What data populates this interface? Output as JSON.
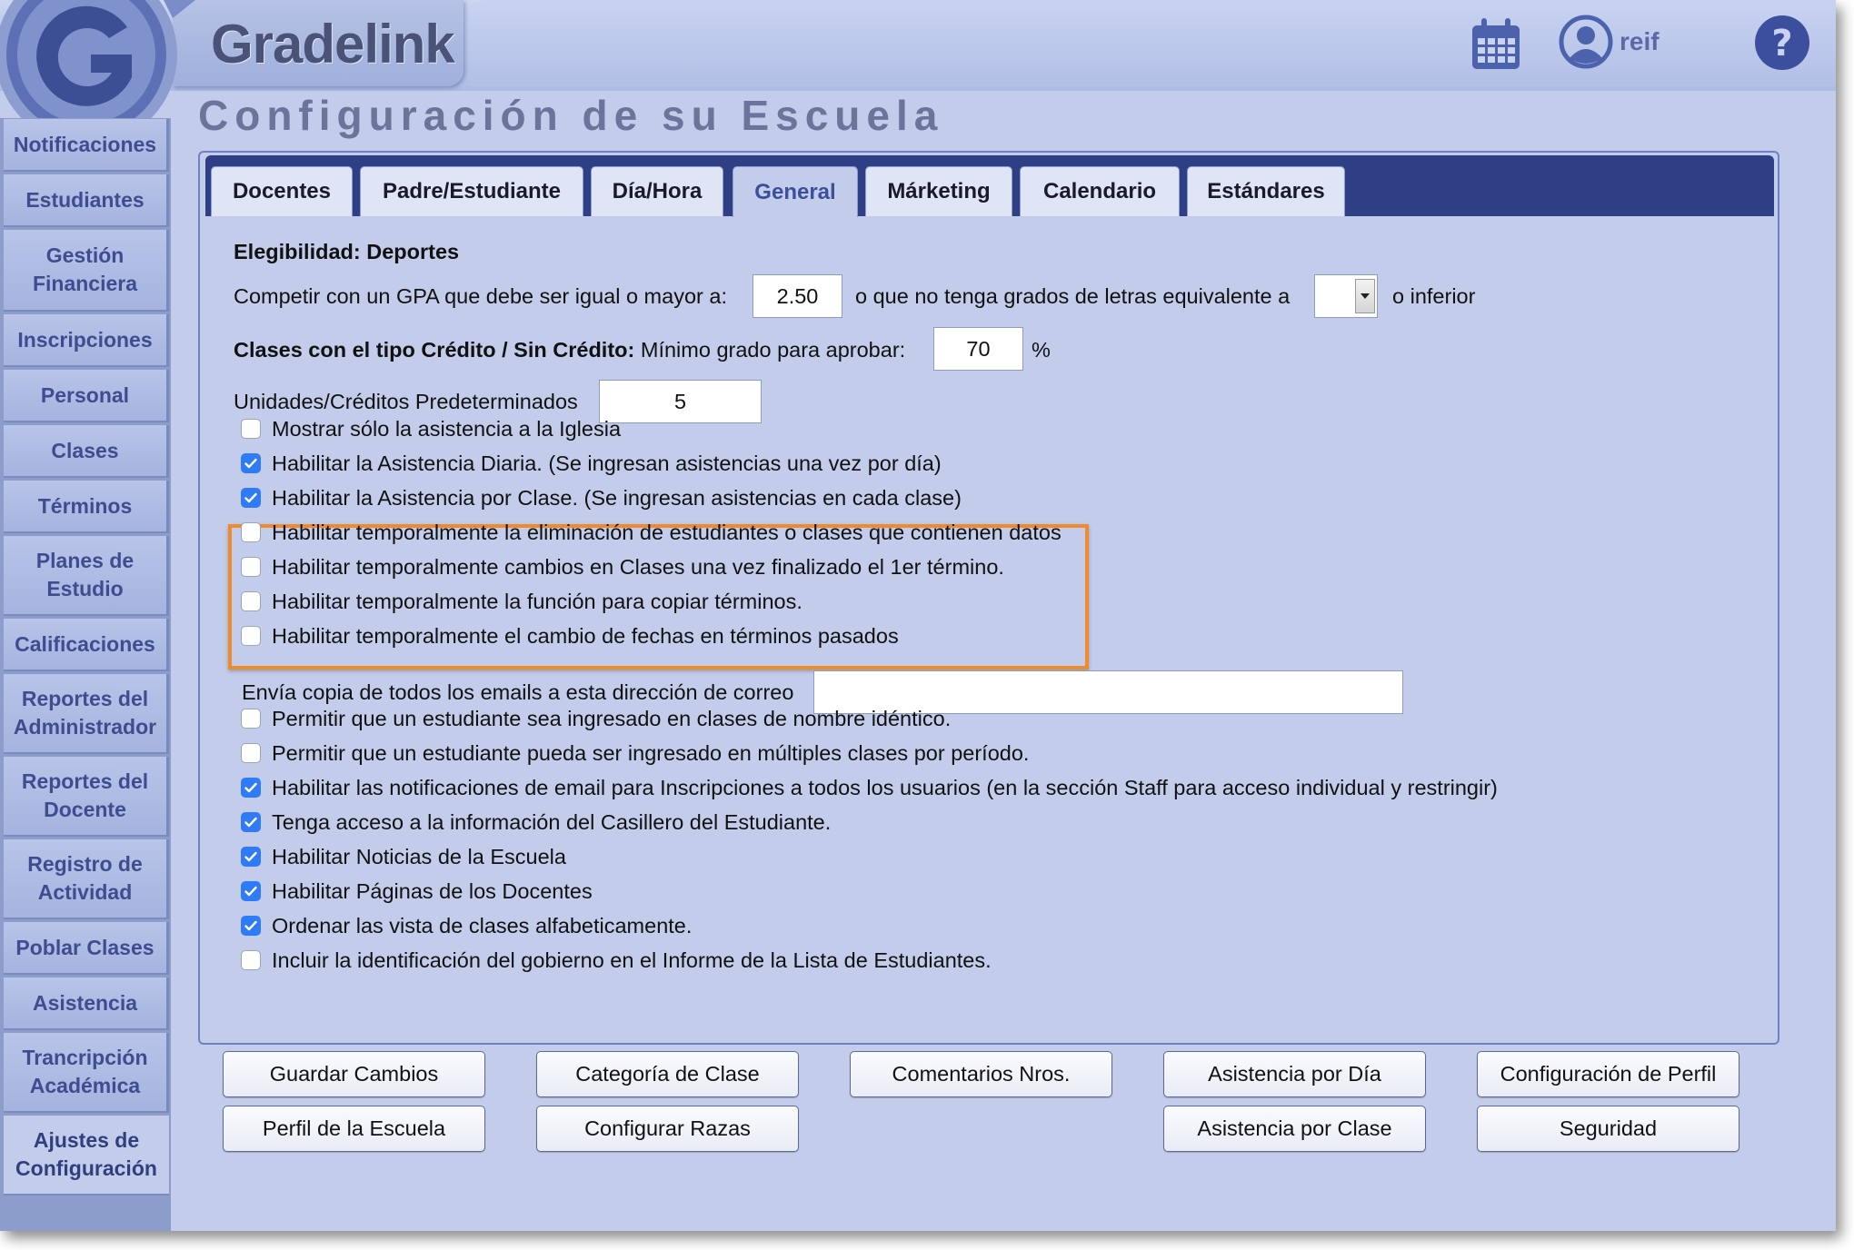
{
  "brand": {
    "name": "Gradelink"
  },
  "header": {
    "user_name": "reif"
  },
  "page": {
    "title": "Configuración de su Escuela"
  },
  "sidebar": {
    "items": [
      "Notificaciones",
      "Estudiantes",
      "Gestión Financiera",
      "Inscripciones",
      "Personal",
      "Clases",
      "Términos",
      "Planes de Estudio",
      "Calificaciones",
      "Reportes del Administrador",
      "Reportes del Docente",
      "Registro de Actividad",
      "Poblar Clases",
      "Asistencia",
      "Trancripción Académica",
      "Ajustes de Configuración"
    ],
    "active": "Ajustes de Configuración"
  },
  "tabs": [
    "Docentes",
    "Padre/Estudiante",
    "Día/Hora",
    "General",
    "Márketing",
    "Calendario",
    "Estándares"
  ],
  "active_tab": "General",
  "form": {
    "eligibility_heading": "Elegibilidad: Deportes",
    "gpa_label": "Competir con un GPA que debe ser igual o mayor a:",
    "gpa_value": "2.50",
    "letter_label": "o que no tenga grados de letras equivalente a",
    "letter_value": "",
    "letter_suffix": "o inferior",
    "credit_label_bold": "Clases con el tipo Crédito / Sin Crédito:",
    "credit_label": "Mínimo grado para aprobar:",
    "credit_value": "70",
    "credit_unit": "%",
    "units_label": "Unidades/Créditos Predeterminados",
    "units_value": "5",
    "email_copy_label": "Envía copia de todos los emails a esta dirección de correo",
    "email_copy_value": ""
  },
  "checkboxes": [
    {
      "label": "Mostrar sólo la asistencia a la Iglesia",
      "checked": false
    },
    {
      "label": "Habilitar la Asistencia Diaria. (Se ingresan asistencias una vez por día)",
      "checked": true
    },
    {
      "label": "Habilitar la Asistencia por Clase. (Se ingresan asistencias en cada clase)",
      "checked": true
    },
    {
      "label": "Habilitar temporalmente la eliminación de estudiantes o clases que contienen datos",
      "checked": false
    },
    {
      "label": "Habilitar temporalmente cambios en Clases una vez finalizado el 1er término.",
      "checked": false
    },
    {
      "label": "Habilitar temporalmente la función para copiar términos.",
      "checked": false
    },
    {
      "label": "Habilitar temporalmente el cambio de fechas en términos pasados",
      "checked": false
    },
    {
      "label": "Permitir que un estudiante sea ingresado en clases de nombre idéntico.",
      "checked": false
    },
    {
      "label": "Permitir que un estudiante pueda ser ingresado en múltiples clases por período.",
      "checked": false
    },
    {
      "label": "Habilitar las notificaciones de email para Inscripciones a todos los usuarios (en la sección Staff para acceso individual y restringir)",
      "checked": true
    },
    {
      "label": "Tenga acceso a la información del Casillero del Estudiante.",
      "checked": true
    },
    {
      "label": "Habilitar Noticias de la Escuela",
      "checked": true
    },
    {
      "label": "Habilitar Páginas de los Docentes",
      "checked": true
    },
    {
      "label": "Ordenar las vista de clases alfabeticamente.",
      "checked": true
    },
    {
      "label": "Incluir la identificación del gobierno en el Informe de la Lista de Estudiantes.",
      "checked": false
    }
  ],
  "buttons": {
    "guardar": "Guardar Cambios",
    "categoria": "Categoría de Clase",
    "comentarios": "Comentarios Nros.",
    "asistencia_dia": "Asistencia por Día",
    "config_perfil": "Configuración de Perfil",
    "perfil_escuela": "Perfil de la Escuela",
    "razas": "Configurar Razas",
    "asistencia_clase": "Asistencia por Clase",
    "seguridad": "Seguridad"
  },
  "colors": {
    "accent": "#2f3f86",
    "highlight": "#f08a2a",
    "checkbox": "#2f7bf5",
    "panel": "#c3cdeb"
  },
  "icons": {
    "logo": "gradelink-logo-icon",
    "calendar": "calendar-icon",
    "user": "user-icon",
    "help": "help-icon",
    "check": "check-icon",
    "dropdown": "chevron-down-icon"
  }
}
